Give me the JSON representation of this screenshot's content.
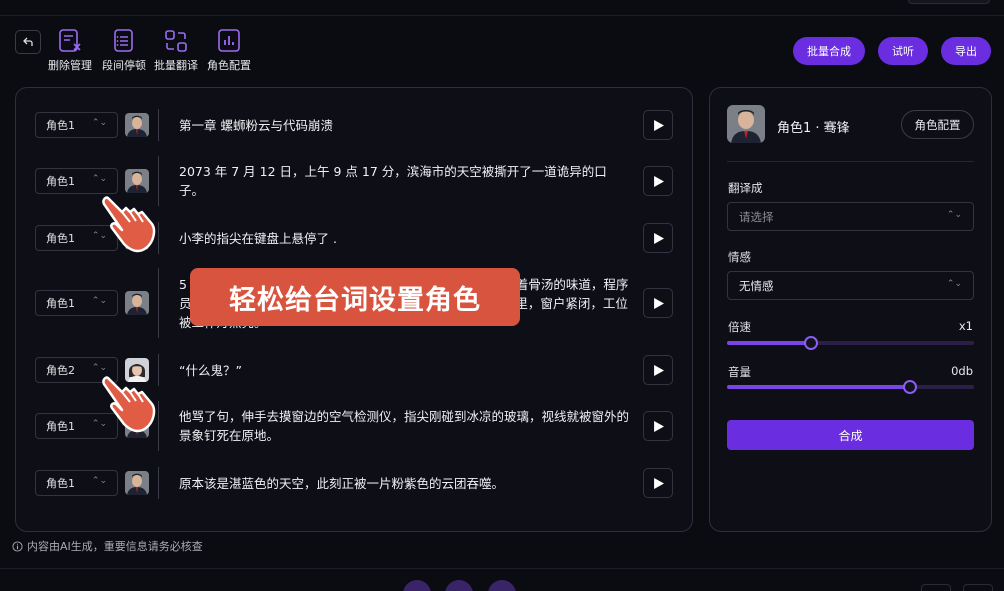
{
  "toolbar": {
    "back_icon": "back-arrow-icon",
    "tools": [
      {
        "label": "删除管理",
        "icon": "delete-manage-icon"
      },
      {
        "label": "段间停顿",
        "icon": "pause-interval-icon"
      },
      {
        "label": "批量翻译",
        "icon": "batch-translate-icon"
      },
      {
        "label": "角色配置",
        "icon": "role-config-icon"
      }
    ],
    "batch_synthesize": "批量合成",
    "preview": "试听",
    "export": "导出",
    "accent_color": "#6a2ee0"
  },
  "lines": [
    {
      "role": "角色1",
      "text": "第一章 螺蛳粉云与代码崩溃"
    },
    {
      "role": "角色1",
      "text": "2073 年 7 月 12 日，上午 9 点 17 分，滨海市的天空被撕开了一道诡异的口子。"
    },
    {
      "role": "角色1",
      "text": "小李的指尖在键盘上悬停了 ."
    },
    {
      "role": "角色1",
      "text": "5 分钟前的事物，空气里还弥漫着一股奇怪的、像是发酵味混着骨汤的味道，程序员小李在这样一个普通的早晨，他正坐在 28 楼的程序员云间里，窗户紧闭，工位被工作灯照亮。"
    },
    {
      "role": "角色2",
      "text": "“什么鬼？”"
    },
    {
      "role": "角色1",
      "text": "他骂了句，伸手去摸窗边的空气检测仪，指尖刚碰到冰凉的玻璃，视线就被窗外的景象钉死在原地。"
    },
    {
      "role": "角色1",
      "text": "原本该是湛蓝色的天空，此刻正被一片粉紫色的云团吞噬。"
    }
  ],
  "overlay_text": "轻松给台词设置角色",
  "settings": {
    "role_name": "角色1 · 骞锋",
    "role_config_button": "角色配置",
    "translate_label": "翻译成",
    "translate_placeholder": "请选择",
    "emotion_label": "情感",
    "emotion_value": "无情感",
    "speed_label": "倍速",
    "speed_value": "x1",
    "speed_fraction": 0.34,
    "volume_label": "音量",
    "volume_value": "0db",
    "volume_fraction": 0.74,
    "synthesize_button": "合成"
  },
  "footnote": "内容由AI生成，重要信息请务必核查"
}
